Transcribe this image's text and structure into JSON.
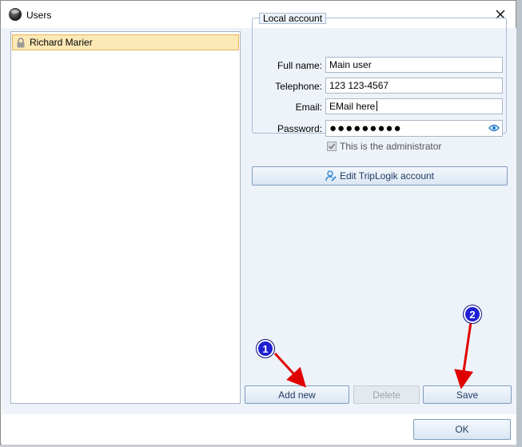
{
  "window": {
    "title": "Users"
  },
  "users": [
    {
      "name": "Richard Marier"
    }
  ],
  "local_account": {
    "caption": "Local account",
    "fields": {
      "full_name": {
        "label": "Full name:",
        "value": "Main user"
      },
      "telephone": {
        "label": "Telephone:",
        "value": "123 123-4567"
      },
      "email": {
        "label": "Email:",
        "value": "EMail here"
      },
      "password": {
        "label": "Password:",
        "masked_value": "●●●●●●●●●"
      }
    },
    "admin_checkbox": {
      "label": "This is the administrator",
      "checked": true
    }
  },
  "buttons": {
    "edit_account": "Edit TripLogik account",
    "add_new": "Add new",
    "delete": "Delete",
    "save": "Save",
    "ok": "OK"
  },
  "annotations": [
    {
      "number": "1"
    },
    {
      "number": "2"
    }
  ],
  "colors": {
    "selection_bg": "#fde9b6",
    "accent": "#2a7fcf",
    "annotation_badge": "#1f1fd4",
    "annotation_arrow": "#e00000"
  },
  "icons": {
    "app": "app-icon",
    "close": "close-icon",
    "lock": "lock-icon",
    "eye": "eye-icon",
    "person": "person-edit-icon",
    "checkmark": "checkmark-icon"
  }
}
